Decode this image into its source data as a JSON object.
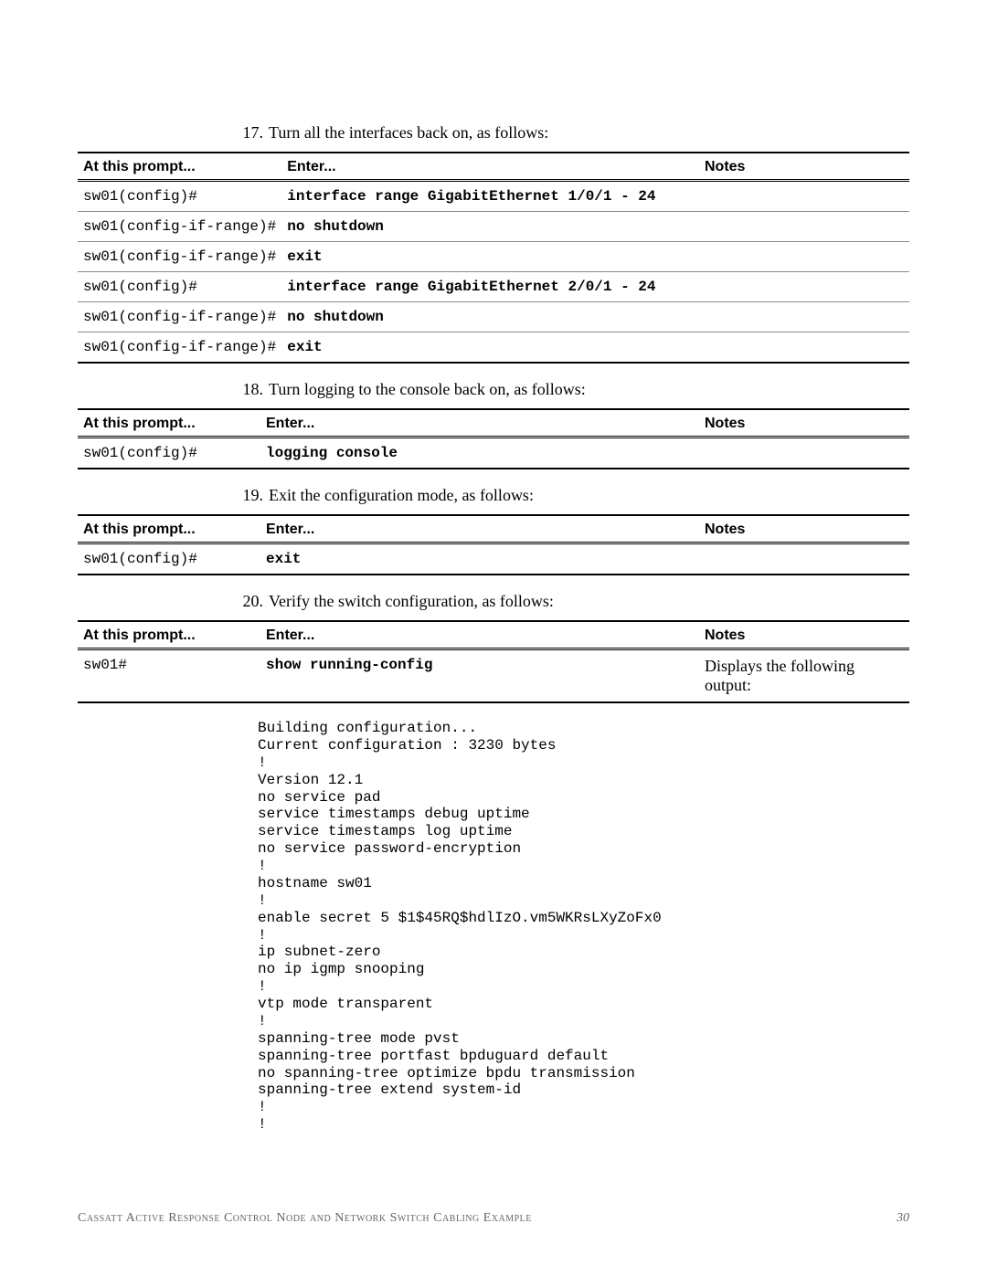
{
  "headers": {
    "prompt": "At this prompt...",
    "enter": "Enter...",
    "notes": "Notes"
  },
  "steps": {
    "s17": {
      "num": "17.",
      "text": "Turn all the interfaces back on, as follows:"
    },
    "s18": {
      "num": "18.",
      "text": "Turn logging to the console back on, as follows:"
    },
    "s19": {
      "num": "19.",
      "text": "Exit the configuration mode, as follows:"
    },
    "s20": {
      "num": "20.",
      "text": "Verify the switch configuration, as follows:"
    }
  },
  "t17": {
    "r0": {
      "prompt": "sw01(config)#",
      "enter": "interface range GigabitEthernet 1/0/1 - 24",
      "notes": ""
    },
    "r1": {
      "prompt": "sw01(config-if-range)#",
      "enter": "no shutdown",
      "notes": ""
    },
    "r2": {
      "prompt": "sw01(config-if-range)#",
      "enter": "exit",
      "notes": ""
    },
    "r3": {
      "prompt": "sw01(config)#",
      "enter": "interface range GigabitEthernet 2/0/1 - 24",
      "notes": ""
    },
    "r4": {
      "prompt": "sw01(config-if-range)#",
      "enter": "no shutdown",
      "notes": ""
    },
    "r5": {
      "prompt": "sw01(config-if-range)#",
      "enter": "exit",
      "notes": ""
    }
  },
  "t18": {
    "r0": {
      "prompt": "sw01(config)#",
      "enter": "logging console",
      "notes": ""
    }
  },
  "t19": {
    "r0": {
      "prompt": "sw01(config)#",
      "enter": "exit",
      "notes": ""
    }
  },
  "t20": {
    "r0": {
      "prompt": "sw01#",
      "enter": "show running-config",
      "notes": "Displays the following output:"
    }
  },
  "output": "Building configuration...\nCurrent configuration : 3230 bytes\n!\nVersion 12.1\nno service pad\nservice timestamps debug uptime\nservice timestamps log uptime\nno service password-encryption\n!\nhostname sw01\n!\nenable secret 5 $1$45RQ$hdlIzO.vm5WKRsLXyZoFx0\n!\nip subnet-zero\nno ip igmp snooping\n!\nvtp mode transparent\n!\nspanning-tree mode pvst\nspanning-tree portfast bpduguard default\nno spanning-tree optimize bpdu transmission\nspanning-tree extend system-id\n!\n!",
  "footer": {
    "left": "Cassatt Active Response   Control Node and Network Switch Cabling Example",
    "right": "30"
  }
}
